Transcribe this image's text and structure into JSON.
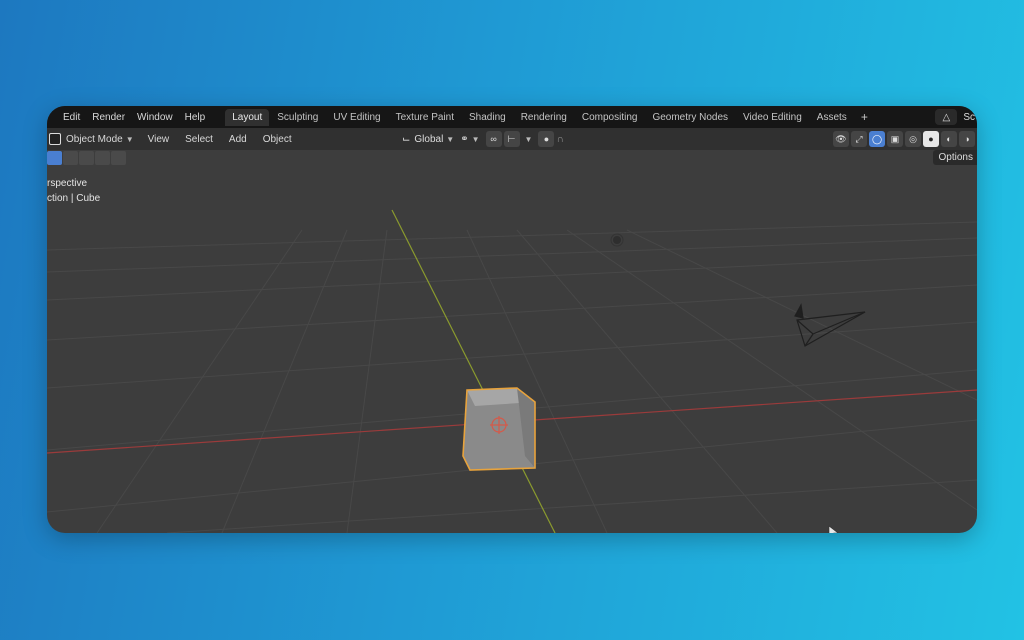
{
  "menu": [
    "Edit",
    "Render",
    "Window",
    "Help"
  ],
  "tabs": [
    "Layout",
    "Sculpting",
    "UV Editing",
    "Texture Paint",
    "Shading",
    "Rendering",
    "Compositing",
    "Geometry Nodes",
    "Video Editing",
    "Assets"
  ],
  "active_tab": "Layout",
  "add_tab_glyph": "+",
  "scene_label": "Sc",
  "header": {
    "mode": "Object Mode",
    "menus": [
      "View",
      "Select",
      "Add",
      "Object"
    ],
    "transform_orientation": "Global"
  },
  "options_label": "Options",
  "viewport": {
    "view_name": "rspective",
    "collection_info": "ction | Cube"
  },
  "colors": {
    "selection_outline": "#e8a33c",
    "x_axis": "#9b3b3b",
    "y_axis": "#8a9a2e",
    "accent": "#4a7fd1"
  },
  "icons": [
    "cube-mode-icon",
    "transform-orientation-icon",
    "snap-icon",
    "proportional-icon",
    "visibility-icon",
    "gizmo-icon",
    "overlay-icon",
    "xray-icon",
    "shading-wireframe-icon",
    "shading-solid-icon",
    "shading-material-icon",
    "shading-rendered-icon",
    "camera-icon",
    "light-icon",
    "origin-icon",
    "mouse-cursor-icon"
  ]
}
